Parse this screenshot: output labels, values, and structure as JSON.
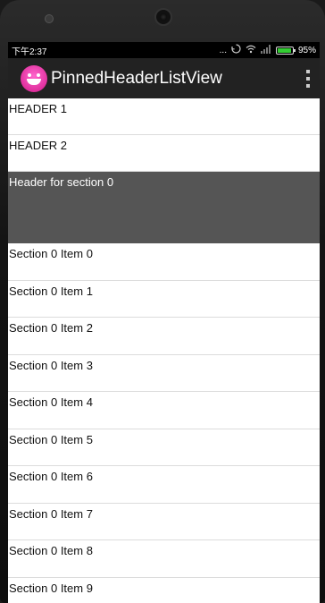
{
  "status_bar": {
    "time": "下午2:37",
    "more": "...",
    "battery_percent": "95%",
    "battery_level": 0.95
  },
  "action_bar": {
    "title": "PinnedHeaderListView",
    "icon": "app-face-icon",
    "overflow_icon": "overflow-menu-icon"
  },
  "list": {
    "headers": [
      "HEADER 1",
      "HEADER 2"
    ],
    "section_header": "Header for section 0",
    "items": [
      "Section 0 Item 0",
      "Section 0 Item 1",
      "Section 0 Item 2",
      "Section 0 Item 3",
      "Section 0 Item 4",
      "Section 0 Item 5",
      "Section 0 Item 6",
      "Section 0 Item 7",
      "Section 0 Item 8",
      "Section 0 Item 9"
    ]
  },
  "colors": {
    "section_header_bg": "#555555",
    "action_bar_bg": "#222222",
    "status_bar_bg": "#000000",
    "battery_fill": "#33cc33",
    "app_icon": "#e0309e"
  }
}
